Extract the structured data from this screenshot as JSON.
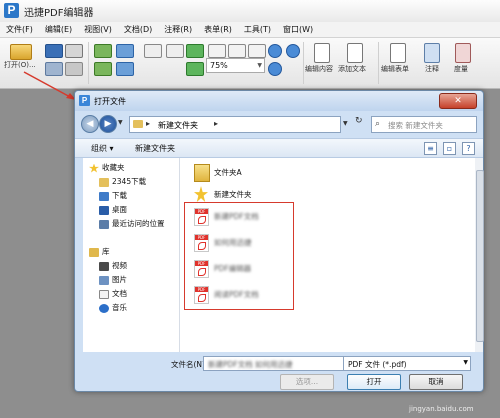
{
  "app": {
    "title": "迅捷PDF编辑器",
    "logo_letter": "P"
  },
  "menu": [
    "文件(F)",
    "编辑(E)",
    "视图(V)",
    "文档(D)",
    "注释(R)",
    "表单(R)",
    "工具(T)",
    "窗口(W)"
  ],
  "toolbar": {
    "open_label": "打开(O)...",
    "zoom_value": "75%",
    "edit_content_label": "编辑内容",
    "add_text_label": "添加文本",
    "edit_form_label": "编辑表单",
    "annotate_label": "注释",
    "measure_label": "度量"
  },
  "dialog": {
    "title": "打开文件",
    "address_path": "新建文件夹",
    "search_placeholder": "搜索 新建文件夹",
    "organize_label": "组织 ▾",
    "new_folder_label": "新建文件夹",
    "nav": [
      {
        "label": "收藏夹",
        "icon": "star-icon"
      },
      {
        "label": "2345下载",
        "icon": "folder-icon"
      },
      {
        "label": "下载",
        "icon": "download-icon"
      },
      {
        "label": "桌面",
        "icon": "desktop-icon"
      },
      {
        "label": "最近访问的位置",
        "icon": "recent-icon"
      },
      {
        "label": "库",
        "icon": "library-icon"
      },
      {
        "label": "视频",
        "icon": "video-icon"
      },
      {
        "label": "图片",
        "icon": "picture-icon"
      },
      {
        "label": "文档",
        "icon": "document-icon"
      },
      {
        "label": "音乐",
        "icon": "music-icon"
      }
    ],
    "files": [
      {
        "name": "文件夹A",
        "type": "folder"
      },
      {
        "name": "新建文件夹",
        "type": "special-folder"
      },
      {
        "name": "新建PDF文档",
        "type": "pdf",
        "obscured": true
      },
      {
        "name": "如何用迅捷",
        "type": "pdf",
        "obscured": true
      },
      {
        "name": "PDF编辑器",
        "type": "pdf",
        "obscured": true
      },
      {
        "name": "阅读PDF文档",
        "type": "pdf",
        "obscured": true
      }
    ],
    "filename_label": "文件名(N):",
    "filename_value": "新建PDF文档 如何用迅捷",
    "filetype_value": "PDF 文件 (*.pdf)",
    "options_label": "选项...",
    "open_button": "打开",
    "cancel_button": "取消"
  },
  "watermark": "jingyan.baidu.com",
  "colors": {
    "highlight_red": "#d63a2d",
    "accent_blue": "#2b77c8",
    "pdf_red": "#e0322c"
  }
}
